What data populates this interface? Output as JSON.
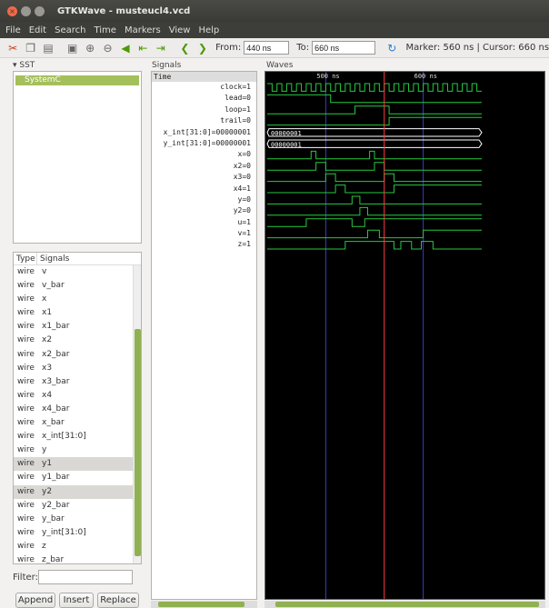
{
  "window": {
    "title": "GTKWave - musteucl4.vcd"
  },
  "menu": [
    "File",
    "Edit",
    "Search",
    "Time",
    "Markers",
    "View",
    "Help"
  ],
  "toolbar": {
    "from_label": "From:",
    "from_value": "440 ns",
    "to_label": "To:",
    "to_value": "660 ns",
    "status": "Marker: 560 ns  |  Cursor: 660 ns"
  },
  "sst": {
    "label": "▾ SST",
    "tree_item": "SystemC"
  },
  "signal_list": {
    "col_type": "Type",
    "col_signals": "Signals",
    "rows": [
      {
        "type": "wire",
        "name": "v"
      },
      {
        "type": "wire",
        "name": "v_bar"
      },
      {
        "type": "wire",
        "name": "x"
      },
      {
        "type": "wire",
        "name": "x1"
      },
      {
        "type": "wire",
        "name": "x1_bar"
      },
      {
        "type": "wire",
        "name": "x2"
      },
      {
        "type": "wire",
        "name": "x2_bar"
      },
      {
        "type": "wire",
        "name": "x3"
      },
      {
        "type": "wire",
        "name": "x3_bar"
      },
      {
        "type": "wire",
        "name": "x4"
      },
      {
        "type": "wire",
        "name": "x4_bar"
      },
      {
        "type": "wire",
        "name": "x_bar"
      },
      {
        "type": "wire",
        "name": "x_int[31:0]"
      },
      {
        "type": "wire",
        "name": "y"
      },
      {
        "type": "wire",
        "name": "y1"
      },
      {
        "type": "wire",
        "name": "y1_bar"
      },
      {
        "type": "wire",
        "name": "y2"
      },
      {
        "type": "wire",
        "name": "y2_bar"
      },
      {
        "type": "wire",
        "name": "y_bar"
      },
      {
        "type": "wire",
        "name": "y_int[31:0]"
      },
      {
        "type": "wire",
        "name": "z"
      },
      {
        "type": "wire",
        "name": "z_bar"
      }
    ]
  },
  "filter": {
    "label": "Filter:",
    "value": ""
  },
  "buttons": {
    "append": "Append",
    "insert": "Insert",
    "replace": "Replace"
  },
  "signals_pane": {
    "label": "Signals",
    "time_header": "Time",
    "names": [
      "clock=1",
      "lead=0",
      "loop=1",
      "trail=0",
      "x_int[31:0]=00000001",
      "y_int[31:0]=00000001",
      "x=0",
      "x2=0",
      "x3=0",
      "x4=1",
      "y=0",
      "y2=0",
      "u=1",
      "v=1",
      "z=1"
    ]
  },
  "waves_pane": {
    "label": "Waves",
    "ticks": [
      {
        "label": "500 ns",
        "t": 500
      },
      {
        "label": "600 ns",
        "t": 600
      }
    ],
    "t_start": 440,
    "t_end": 660,
    "marker_t": 560,
    "bus_values": {
      "x_int": "00000001",
      "y_int": "00000001"
    },
    "colors": {
      "wave": "#27c93f",
      "bus": "#ffffff",
      "marker": "#ff3b3b",
      "cursor": "#4a4aff",
      "grid": "#3c3ccc"
    }
  }
}
